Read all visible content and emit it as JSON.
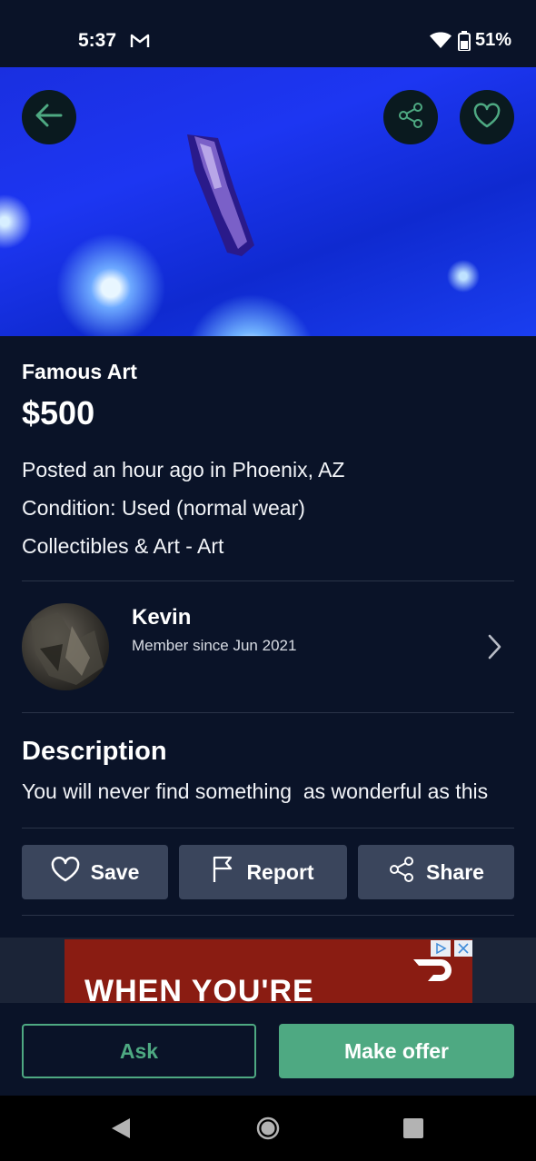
{
  "status_bar": {
    "time": "5:37",
    "battery": "51%"
  },
  "listing": {
    "title": "Famous Art",
    "price": "$500",
    "posted": "Posted an hour ago in Phoenix, AZ",
    "condition": "Condition: Used (normal wear)",
    "category": "Collectibles & Art - Art"
  },
  "seller": {
    "name": "Kevin",
    "member_since": "Member since Jun 2021"
  },
  "description": {
    "heading": "Description",
    "text": "You will never find something  as wonderful as this"
  },
  "actions": {
    "save": "Save",
    "report": "Report",
    "share": "Share"
  },
  "ad": {
    "headline": "WHEN YOU'RE"
  },
  "bottom": {
    "ask": "Ask",
    "make_offer": "Make offer"
  },
  "colors": {
    "background": "#0a1328",
    "accent": "#4ea982",
    "button_bg": "#3a455c"
  },
  "icons": [
    "arrow-left-icon",
    "share-icon",
    "heart-icon",
    "flag-icon",
    "chevron-right-icon",
    "gmail-icon",
    "wifi-icon",
    "battery-icon"
  ]
}
